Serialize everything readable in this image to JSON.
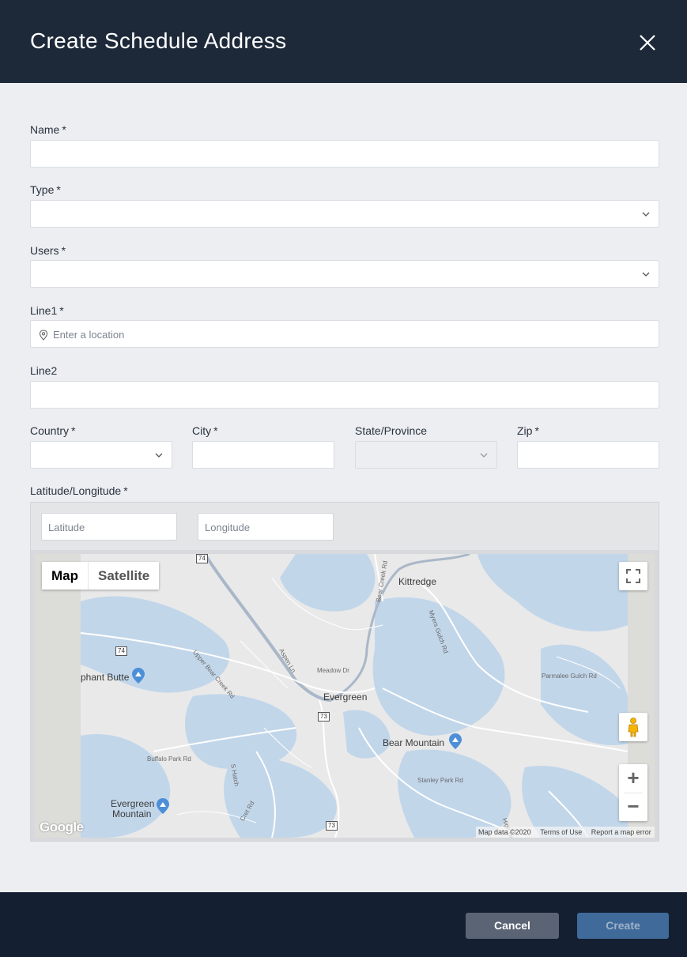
{
  "header": {
    "title": "Create Schedule Address"
  },
  "form": {
    "name": {
      "label": "Name",
      "required": "*"
    },
    "type": {
      "label": "Type",
      "required": "*"
    },
    "users": {
      "label": "Users",
      "required": "*"
    },
    "line1": {
      "label": "Line1",
      "required": "*",
      "placeholder": "Enter a location"
    },
    "line2": {
      "label": "Line2"
    },
    "country": {
      "label": "Country",
      "required": "*"
    },
    "city": {
      "label": "City",
      "required": "*"
    },
    "state": {
      "label": "State/Province"
    },
    "zip": {
      "label": "Zip",
      "required": "*"
    },
    "latlng": {
      "label": "Latitude/Longitude",
      "required": "*",
      "lat_placeholder": "Latitude",
      "lng_placeholder": "Longitude"
    }
  },
  "map": {
    "type_map": "Map",
    "type_satellite": "Satellite",
    "places": {
      "kittredge": "Kittredge",
      "elephant_butte": "phant Butte",
      "evergreen": "Evergreen",
      "bear_mountain": "Bear Mountain",
      "evergreen_mountain_1": "Evergreen",
      "evergreen_mountain_2": "Mountain"
    },
    "roads": {
      "bear_creek_rd": "Bear Creek Rd",
      "myers_gulch": "Myers Gulch Rd",
      "upper_bear_creek": "Upper Bear Creek Rd",
      "aspen_ln": "Aspen Ln",
      "meadow_dr": "Meadow Dr",
      "parmalee": "Parmalee Gulch Rd",
      "buffalo_park": "Buffalo Park Rd",
      "stanley_park": "Stanley Park Rd",
      "s_hatch": "S Hatch",
      "cret_rd": "Cret Rd",
      "high_dr": "High Dr"
    },
    "shields": {
      "s74_top": "74",
      "s74_left": "74",
      "s73_mid": "73",
      "s73_bottom": "73"
    },
    "google_logo": "Google",
    "attribution": {
      "data": "Map data ©2020",
      "terms": "Terms of Use",
      "report": "Report a map error"
    },
    "zoom_in": "+",
    "zoom_out": "−"
  },
  "footer": {
    "cancel": "Cancel",
    "create": "Create"
  },
  "colors": {
    "header_bg": "#1d2939",
    "footer_bg": "#142031",
    "cancel_bg": "#5a6474",
    "create_bg": "#3f6a9a",
    "water": "#c2d6ea",
    "land": "#e8e8e8"
  },
  "icons": {
    "close": "close-icon",
    "chevron": "chevron-down-icon",
    "pin": "location-pin-icon",
    "fullscreen": "fullscreen-icon",
    "pegman": "street-view-pegman-icon",
    "peak": "mountain-peak-icon"
  }
}
